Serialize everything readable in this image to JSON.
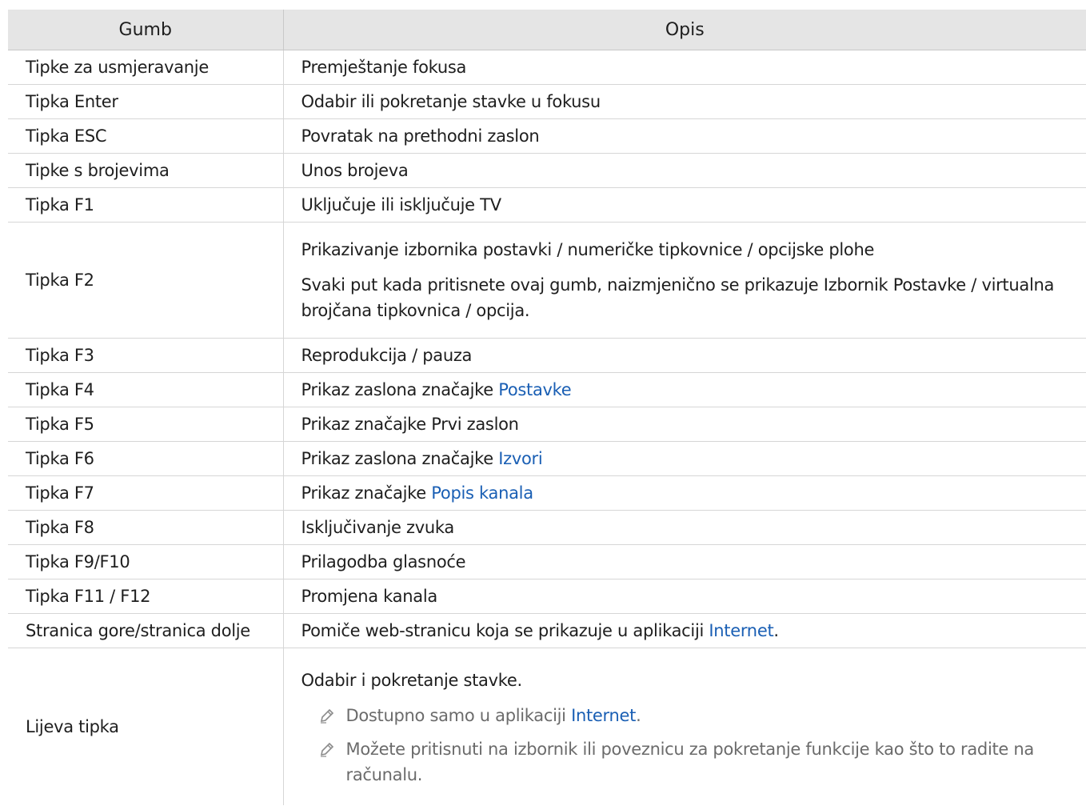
{
  "header": {
    "col1": "Gumb",
    "col2": "Opis"
  },
  "rows": [
    {
      "key": "Tipke za usmjeravanje",
      "desc": "Premještanje fokusa"
    },
    {
      "key": "Tipka Enter",
      "desc": "Odabir ili pokretanje stavke u fokusu"
    },
    {
      "key": "Tipka ESC",
      "desc": "Povratak na prethodni zaslon"
    },
    {
      "key": "Tipke s brojevima",
      "desc": "Unos brojeva"
    },
    {
      "key": "Tipka F1",
      "desc": "Uključuje ili isključuje TV"
    },
    {
      "key": "Tipka F2",
      "desc1": "Prikazivanje izbornika postavki / numeričke tipkovnice / opcijske plohe",
      "desc2": "Svaki put kada pritisnete ovaj gumb, naizmjenično se prikazuje Izbornik Postavke / virtualna brojčana tipkovnica / opcija."
    },
    {
      "key": "Tipka F3",
      "desc": "Reprodukcija / pauza"
    },
    {
      "key": "Tipka F4",
      "desc": "Prikaz zaslona značajke ",
      "link": "Postavke"
    },
    {
      "key": "Tipka F5",
      "desc": "Prikaz značajke Prvi zaslon"
    },
    {
      "key": "Tipka F6",
      "desc": "Prikaz zaslona značajke ",
      "link": "Izvori"
    },
    {
      "key": "Tipka F7",
      "desc": "Prikaz značajke ",
      "link": "Popis kanala"
    },
    {
      "key": "Tipka F8",
      "desc": "Isključivanje zvuka"
    },
    {
      "key": "Tipka F9/F10",
      "desc": "Prilagodba glasnoće"
    },
    {
      "key": "Tipka F11 / F12",
      "desc": "Promjena kanala"
    },
    {
      "key": "Stranica gore/stranica dolje",
      "desc": "Pomiče web-stranicu koja se prikazuje u aplikaciji ",
      "link": "Internet",
      "after": "."
    },
    {
      "key": "Lijeva tipka",
      "desc": "Odabir i pokretanje stavke.",
      "note1_pre": "Dostupno samo u aplikaciji ",
      "note1_link": "Internet",
      "note1_post": ".",
      "note2": "Možete pritisnuti na izbornik ili poveznicu za pokretanje funkcije kao što to radite na računalu."
    }
  ],
  "icons": {
    "note": "pencil-note-icon"
  },
  "colors": {
    "link": "#1a5fb4",
    "header_bg": "#e5e5e5",
    "note_text": "#6b6b6b"
  }
}
